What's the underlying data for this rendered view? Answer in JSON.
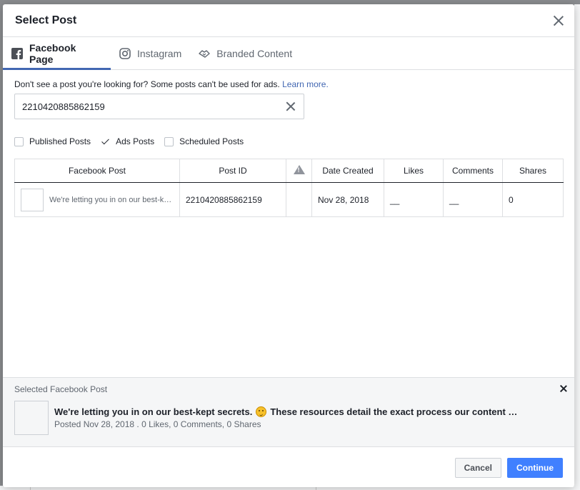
{
  "modal": {
    "title": "Select Post"
  },
  "tabs": [
    {
      "label": "Facebook Page",
      "icon": "facebook-icon",
      "active": true
    },
    {
      "label": "Instagram",
      "icon": "instagram-icon",
      "active": false
    },
    {
      "label": "Branded Content",
      "icon": "handshake-icon",
      "active": false
    }
  ],
  "hint": {
    "text": "Don't see a post you're looking for? Some posts can't be used for ads.",
    "link": "Learn more."
  },
  "search": {
    "value": "2210420885862159",
    "placeholder": ""
  },
  "filters": [
    {
      "label": "Published Posts",
      "checked": false
    },
    {
      "label": "Ads Posts",
      "checked": true
    },
    {
      "label": "Scheduled Posts",
      "checked": false
    }
  ],
  "table": {
    "headers": [
      "Facebook Post",
      "Post ID",
      "",
      "Date Created",
      "Likes",
      "Comments",
      "Shares"
    ],
    "rows": [
      {
        "post": "We're letting you in on our best-kept secrets. 😉 These resources detail the exact process our content …",
        "post_id": "2210420885862159",
        "warning": "",
        "date": "Nov 28, 2018",
        "likes": "__",
        "comments": "__",
        "shares": "0"
      }
    ]
  },
  "selected": {
    "title": "Selected Facebook Post",
    "message_before": "We're letting you in on our best-kept secrets.",
    "message_after": "These resources detail the exact process our content …",
    "meta": "Posted Nov 28, 2018 . 0 Likes, 0 Comments, 0 Shares"
  },
  "footer": {
    "cancel": "Cancel",
    "continue": "Continue"
  },
  "colors": {
    "accent": "#4267b2",
    "primary_button": "#4080ff"
  }
}
